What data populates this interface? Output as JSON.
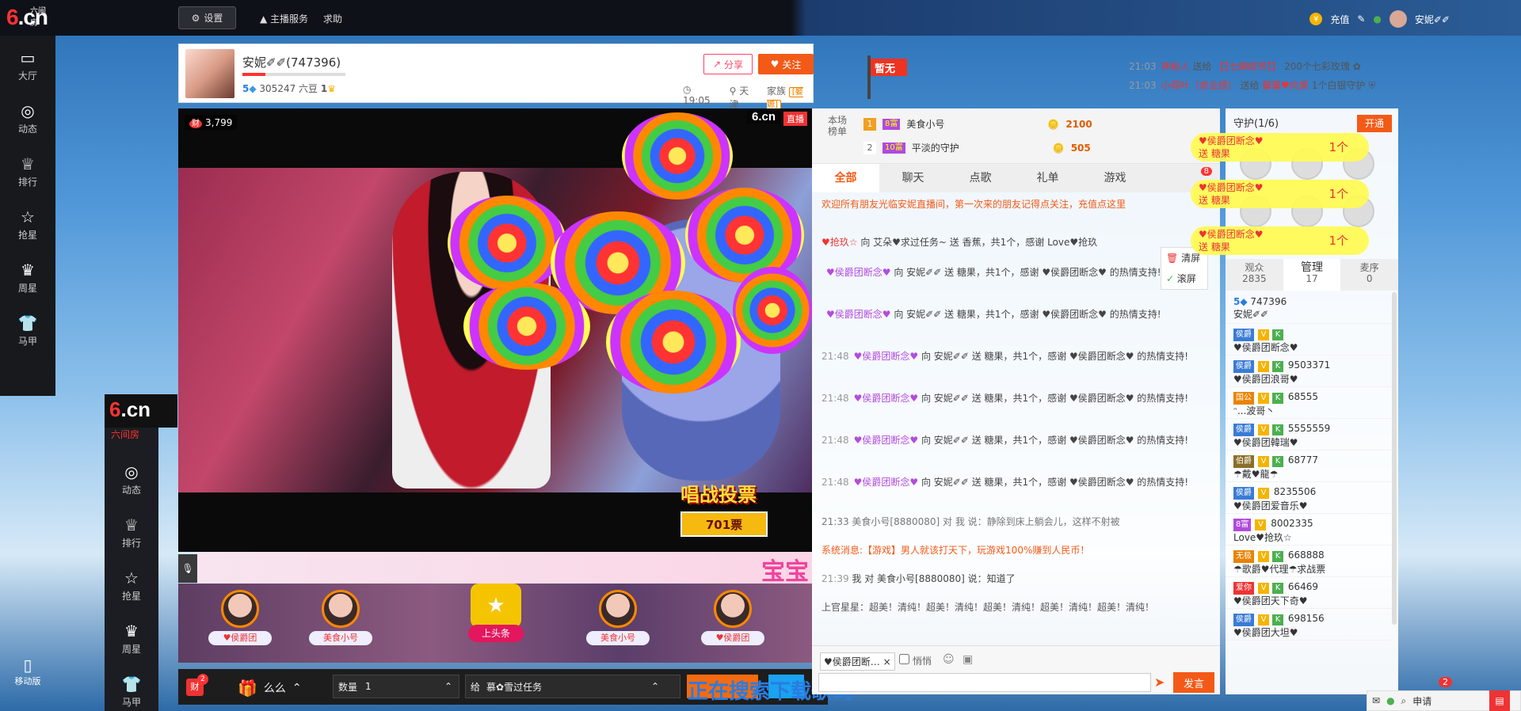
{
  "topbar": {
    "logo": "6.cn",
    "logo_sub": "六间房",
    "settings": "设置",
    "anchor_service": "主播服务",
    "help": "求助",
    "recharge": "充值",
    "user_name": "安妮✐✐"
  },
  "sidebar": {
    "items": [
      {
        "label": "大厅",
        "icon": "tv-icon"
      },
      {
        "label": "动态",
        "icon": "compass-icon"
      },
      {
        "label": "排行",
        "icon": "crown-icon"
      },
      {
        "label": "抢星",
        "icon": "star-icon"
      },
      {
        "label": "周星",
        "icon": "cup-icon"
      },
      {
        "label": "马甲",
        "icon": "shirt-icon"
      }
    ],
    "mobile": "移动版",
    "sub_labels": [
      "六间房",
      "动态",
      "排行",
      "抢星",
      "周星",
      "马甲"
    ]
  },
  "host": {
    "name": "安妮✐✐(747396)",
    "level": "5",
    "beans": "305247 六豆",
    "fans_level": "1",
    "share": "分享",
    "follow": "关注",
    "time": "19:05",
    "city": "天津",
    "family_label": "家族",
    "family_badge": "[娶嫄]",
    "flag": "暂无"
  },
  "gift_feed": [
    {
      "time": "21:03",
      "user": "神秘人",
      "verb": "送给",
      "target": "【【七歸統爷】】",
      "gift": "200个七彩玫瑰"
    },
    {
      "time": "21:03",
      "user": "小荷叶（求业绩）",
      "verb": "送给",
      "target": "馨馨♥向果",
      "gift": "1个白银守护"
    }
  ],
  "video": {
    "rich": "3,799",
    "rich_icon": "财",
    "brand": "6.cn",
    "live": "直播",
    "vote_title": "唱战投票",
    "vote_count": "701票",
    "banner": "宝宝"
  },
  "gifters": [
    {
      "name": "♥侯爵团"
    },
    {
      "name": "美食小号"
    },
    {
      "name": "美食小号"
    },
    {
      "name": "♥侯爵团"
    }
  ],
  "toutiao": "上头条",
  "gift_bar": {
    "rich_count": "2",
    "rich_label": "财",
    "gift_name": "么么",
    "qty_label": "数量",
    "qty_value": "1",
    "to_label": "给",
    "to_value": "慕✿雪过任务",
    "lyric_overlay": "正在搜索下载歌词"
  },
  "rank": {
    "label": "本场榜单",
    "rows": [
      {
        "no": "1",
        "lv": "8富",
        "name": "美食小号",
        "score": "2100"
      },
      {
        "no": "2",
        "lv": "10富",
        "name": "平淡的守护",
        "score": "505"
      }
    ]
  },
  "chat_tabs": [
    "全部",
    "聊天",
    "点歌",
    "礼单",
    "游戏"
  ],
  "chat_tab_badge": "8",
  "chat": {
    "welcome": "欢迎所有朋友光临安妮直播间，第一次来的朋友记得点关注，充值点这里",
    "first": {
      "user": "♥抢玖☆",
      "text": "向 艾朵♥求过任务~ 送 香蕉，共1个，感谢 Love♥抢玖"
    },
    "messages": [
      {
        "time": "",
        "user": "♥侯爵团断念♥",
        "text": "向 安妮✐✐ 送 糖果，共1个，感谢 ♥侯爵团断念♥ 的热情支持!"
      },
      {
        "time": "",
        "user": "♥侯爵团断念♥",
        "text": "向 安妮✐✐ 送 糖果，共1个，感谢 ♥侯爵团断念♥ 的热情支持!"
      },
      {
        "time": "21:48",
        "user": "♥侯爵团断念♥",
        "text": "向 安妮✐✐ 送 糖果，共1个，感谢 ♥侯爵团断念♥ 的热情支持!"
      },
      {
        "time": "21:48",
        "user": "♥侯爵团断念♥",
        "text": "向 安妮✐✐ 送 糖果，共1个，感谢 ♥侯爵团断念♥ 的热情支持!"
      },
      {
        "time": "21:48",
        "user": "♥侯爵团断念♥",
        "text": "向 安妮✐✐ 送 糖果，共1个，感谢 ♥侯爵团断念♥ 的热情支持!"
      },
      {
        "time": "21:48",
        "user": "♥侯爵团断念♥",
        "text": "向 安妮✐✐ 送 糖果，共1个，感谢 ♥侯爵团断念♥ 的热情支持!"
      }
    ],
    "line_2133": "21:33  美食小号[8880080] 对 我 说：静除到床上躺会儿，这样不射被",
    "system": "系统消息:【游戏】男人就该打天下，玩游戏100%赚到人民币！",
    "line_2139_time": "21:39",
    "line_2139": "我 对 美食小号[8880080] 说：知道了",
    "last": "上官星星：超美！清纯！超美！清纯！超美！清纯！超美！清纯！超美！清纯！",
    "clear": "清屏",
    "scroll": "滚屏"
  },
  "chat_input": {
    "target": "♥侯爵团断…",
    "quiet": "悄悄",
    "send": "发言",
    "placeholder": ""
  },
  "guard": {
    "title": "守护(1/6)",
    "open": "开通"
  },
  "gift_pops": [
    {
      "user": "♥侯爵团断念♥",
      "gift": "送 糖果",
      "count": "1个"
    },
    {
      "user": "♥侯爵团断念♥",
      "gift": "送 糖果",
      "count": "1个"
    },
    {
      "user": "♥侯爵团断念♥",
      "gift": "送 糖果",
      "count": "1个"
    }
  ],
  "user_tabs": [
    {
      "label": "观众",
      "count": "2835"
    },
    {
      "label": "管理",
      "count": "17"
    },
    {
      "label": "麦序",
      "count": "0"
    }
  ],
  "users": [
    {
      "role": "",
      "id": "747396",
      "name": "安妮✐✐"
    },
    {
      "role": "侯爵",
      "id": "",
      "name": "♥侯爵团断念♥"
    },
    {
      "role": "侯爵",
      "id": "9503371",
      "name": "♥侯爵团浪哥♥"
    },
    {
      "role": "国公",
      "id": "68555",
      "name": "ᵔ...波哥丶"
    },
    {
      "role": "侯爵",
      "id": "5555559",
      "name": "♥侯爵团韓瑞♥"
    },
    {
      "role": "伯爵",
      "id": "68777",
      "name": "☂戴♥龍☂"
    },
    {
      "role": "侯爵",
      "id": "8235506",
      "name": "♥侯爵团爱音乐♥"
    },
    {
      "role": "8富",
      "id": "8002335",
      "name": "Love♥抢玖☆"
    },
    {
      "role": "无极",
      "id": "668888",
      "name": "☂歌爵♥代理☂求战票"
    },
    {
      "role": "爱你",
      "id": "66469",
      "name": "♥侯爵团天下奇♥"
    },
    {
      "role": "侯爵",
      "id": "698156",
      "name": "♥侯爵团大坦♥"
    }
  ],
  "bottom_right": {
    "apply": "申请",
    "apply_badge": "2"
  }
}
